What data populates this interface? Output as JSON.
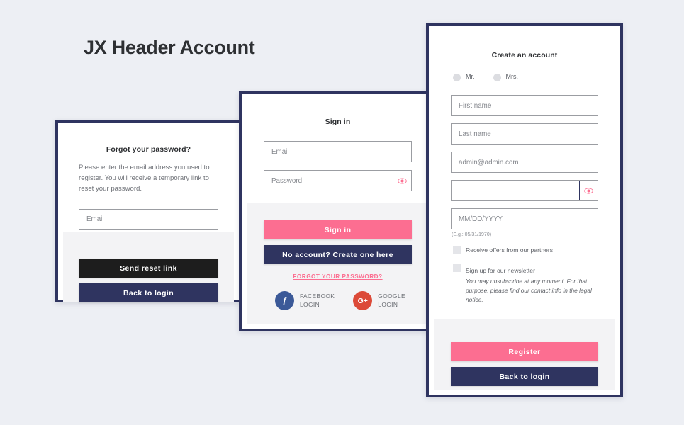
{
  "page": {
    "title": "JX Header Account",
    "background_color": "#edeff4"
  },
  "colors": {
    "pink": "#fc6e91",
    "navy": "#2f3460",
    "black": "#1d1d1d",
    "facebook_blue": "#3b5998",
    "google_red": "#dc4a38"
  },
  "forgot_panel": {
    "title": "Forgot your password?",
    "description": "Please enter the email address you used to register. You will receive a temporary link to reset your password.",
    "email_placeholder": "Email",
    "send_label": "Send reset link",
    "back_label": "Back to login"
  },
  "signin_panel": {
    "title": "Sign in",
    "close_icon": "close-icon",
    "email_placeholder": "Email",
    "password_placeholder": "Password",
    "password_toggle_icon": "eye-icon",
    "signin_label": "Sign in",
    "create_label": "No account? Create one here",
    "forgot_link": "FORGOT YOUR PASSWORD?",
    "social": [
      {
        "icon": "facebook-icon",
        "glyph": "f",
        "line1": "FACEBOOK",
        "line2": "LOGIN"
      },
      {
        "icon": "google-plus-icon",
        "glyph": "G+",
        "line1": "GOOGLE",
        "line2": "LOGIN"
      }
    ]
  },
  "register_panel": {
    "title": "Create an account",
    "close_icon": "close-icon",
    "social_title_options": [
      {
        "label": "Mr."
      },
      {
        "label": "Mrs."
      }
    ],
    "first_name_placeholder": "First name",
    "last_name_placeholder": "Last name",
    "email_value": "admin@admin.com",
    "password_value": "········",
    "password_toggle_icon": "eye-icon",
    "birthday_placeholder": "MM/DD/YYYY",
    "birthday_hint": "(E.g.: 05/31/1970)",
    "checkboxes": [
      {
        "label": "Receive offers from our partners",
        "note": ""
      },
      {
        "label": "Sign up for our newsletter",
        "note": "You may unsubscribe at any moment. For that purpose, please find our contact info in the legal notice."
      }
    ],
    "register_label": "Register",
    "back_label": "Back to login"
  }
}
